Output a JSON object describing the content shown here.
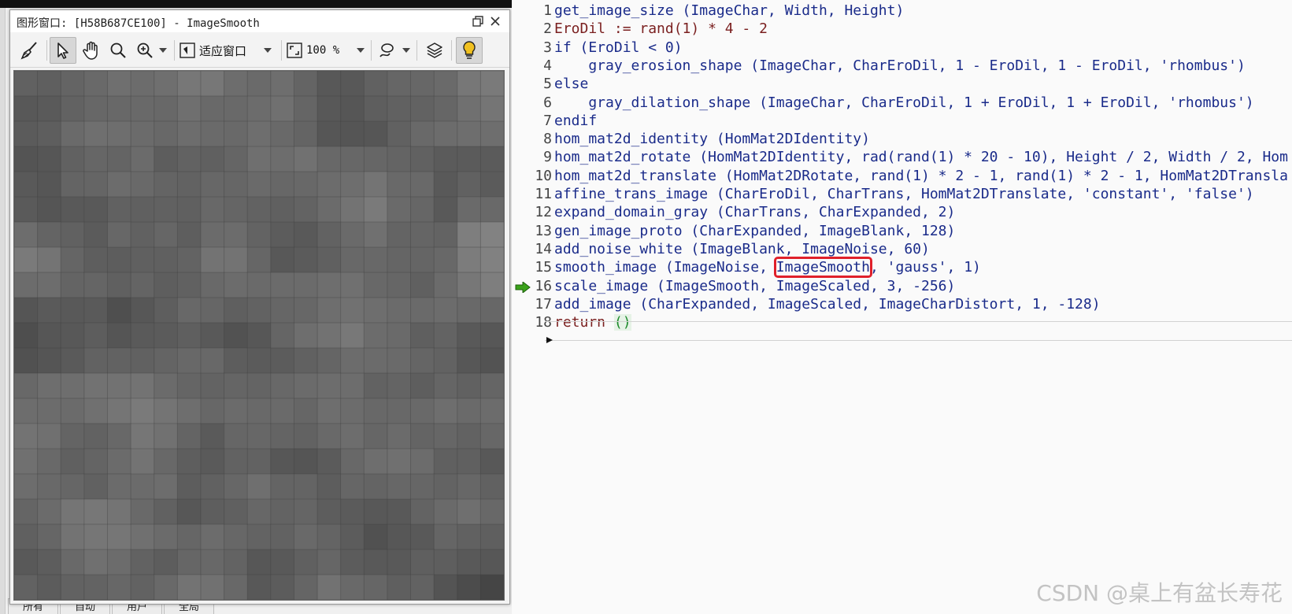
{
  "background_app": {
    "tabs": [
      "所有",
      "自动",
      "用户",
      "全局"
    ]
  },
  "graphics_window": {
    "title": "图形窗口: [H58B687CE100] - ImageSmooth",
    "toolbar": {
      "fit_window_label": "适应窗口",
      "zoom_label": "100 %"
    }
  },
  "editor": {
    "current_line": 16,
    "highlighted_token": "ImageSmooth",
    "lines": [
      {
        "num": "1",
        "text": "get_image_size (ImageChar, Width, Height)"
      },
      {
        "num": "2",
        "text": "EroDil := rand(1) * 4 - 2"
      },
      {
        "num": "3",
        "text": "if (EroDil < 0)"
      },
      {
        "num": "4",
        "text": "    gray_erosion_shape (ImageChar, CharEroDil, 1 - EroDil, 1 - EroDil, 'rhombus')"
      },
      {
        "num": "5",
        "text": "else"
      },
      {
        "num": "6",
        "text": "    gray_dilation_shape (ImageChar, CharEroDil, 1 + EroDil, 1 + EroDil, 'rhombus')"
      },
      {
        "num": "7",
        "text": "endif"
      },
      {
        "num": "8",
        "text": "hom_mat2d_identity (HomMat2DIdentity)"
      },
      {
        "num": "9",
        "text": "hom_mat2d_rotate (HomMat2DIdentity, rad(rand(1) * 20 - 10), Height / 2, Width / 2, Hom"
      },
      {
        "num": "10",
        "text": "hom_mat2d_translate (HomMat2DRotate, rand(1) * 2 - 1, rand(1) * 2 - 1, HomMat2DTransla"
      },
      {
        "num": "11",
        "text": "affine_trans_image (CharEroDil, CharTrans, HomMat2DTranslate, 'constant', 'false')"
      },
      {
        "num": "12",
        "text": "expand_domain_gray (CharTrans, CharExpanded, 2)"
      },
      {
        "num": "13",
        "text": "gen_image_proto (CharExpanded, ImageBlank, 128)"
      },
      {
        "num": "14",
        "text": "add_noise_white (ImageBlank, ImageNoise, 60)"
      },
      {
        "num": "15",
        "text_before": "smooth_image (ImageNoise, ",
        "text_hl": "ImageSmooth",
        "text_after": ", 'gauss', 1)"
      },
      {
        "num": "16",
        "text": "scale_image (ImageSmooth, ImageScaled, 3, -256)"
      },
      {
        "num": "17",
        "text": "add_image (CharExpanded, ImageScaled, ImageCharDistort, 1, -128)"
      },
      {
        "num": "18",
        "text_kw": "return ",
        "text_paren": "()"
      }
    ]
  },
  "watermark": "CSDN @桌上有盆长寿花",
  "colors": {
    "code_text": "#1a2b8a",
    "keyword": "#7a1f1f",
    "highlight_box": "#e0202a",
    "pc_arrow": "#3aa21a"
  }
}
